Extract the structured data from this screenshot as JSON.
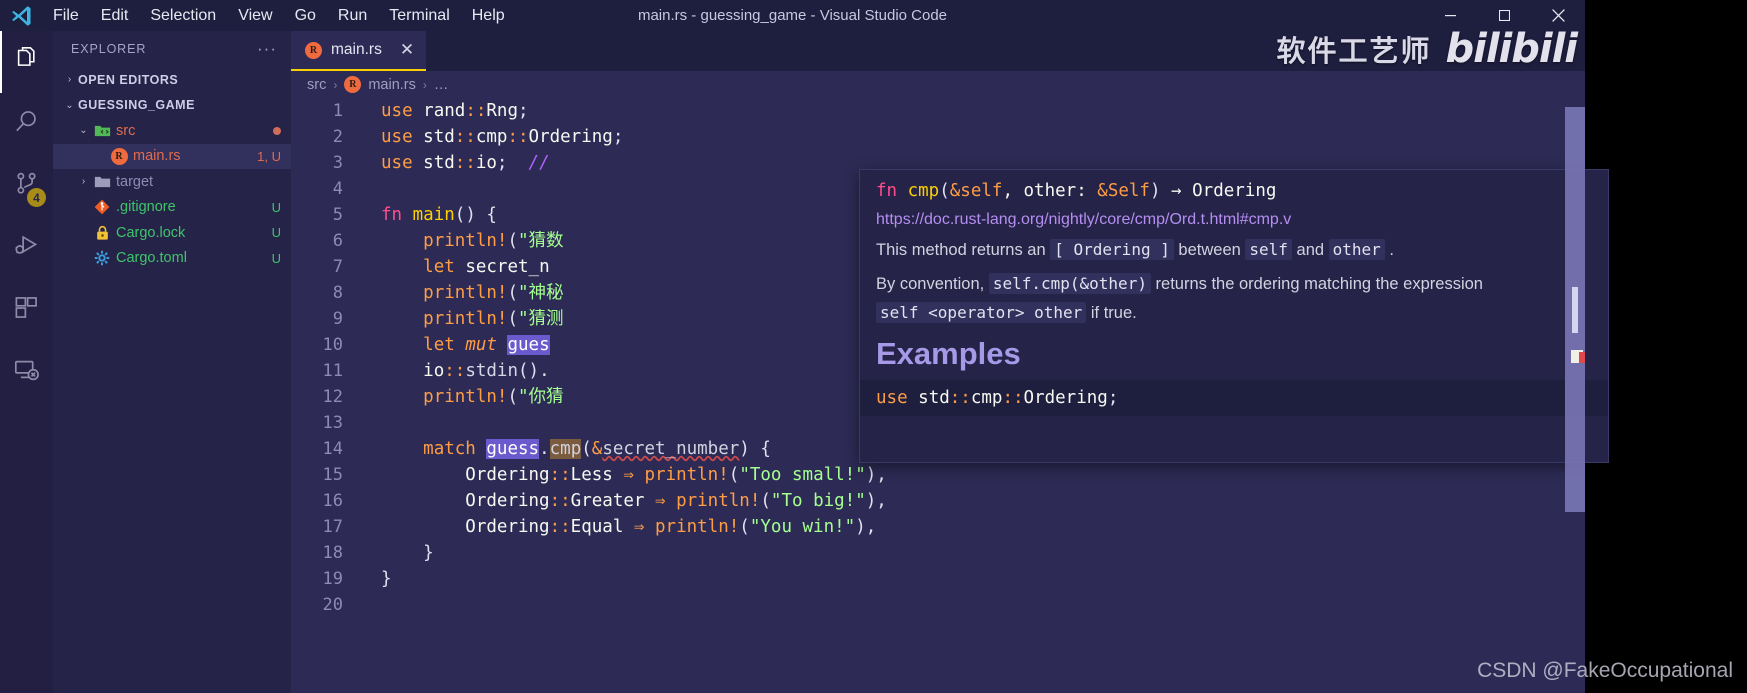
{
  "window": {
    "title": "main.rs - guessing_game - Visual Studio Code",
    "minimize_label": "─",
    "maximize_label": "❐",
    "close_label": "✕"
  },
  "menubar": {
    "items": [
      {
        "label": "File"
      },
      {
        "label": "Edit"
      },
      {
        "label": "Selection"
      },
      {
        "label": "View"
      },
      {
        "label": "Go"
      },
      {
        "label": "Run"
      },
      {
        "label": "Terminal"
      },
      {
        "label": "Help"
      }
    ]
  },
  "activitybar": {
    "items": [
      {
        "name": "explorer",
        "icon": "files-icon",
        "active": true,
        "badge": ""
      },
      {
        "name": "search",
        "icon": "search-icon",
        "active": false,
        "badge": ""
      },
      {
        "name": "source-control",
        "icon": "source-control-icon",
        "active": false,
        "badge": "4"
      },
      {
        "name": "run-and-debug",
        "icon": "run-debug-icon",
        "active": false,
        "badge": ""
      },
      {
        "name": "extensions",
        "icon": "extensions-icon",
        "active": false,
        "badge": ""
      },
      {
        "name": "remote-explorer",
        "icon": "remote-explorer-icon",
        "active": false,
        "badge": ""
      }
    ]
  },
  "sidebar": {
    "title": "EXPLORER",
    "more_actions": "···",
    "sections": [
      {
        "label": "OPEN EDITORS",
        "expanded": false,
        "chevron": "›"
      },
      {
        "label": "GUESSING_GAME",
        "expanded": true,
        "chevron": "⌄"
      }
    ],
    "tree": [
      {
        "name": "src",
        "icon": "folder-src-icon",
        "chevron": "⌄",
        "indent": 1,
        "status": "",
        "modified_dot": true,
        "selected": false,
        "color": "#e06c4f"
      },
      {
        "name": "main.rs",
        "icon": "rust-file-icon",
        "chevron": "",
        "indent": 2,
        "status": "1, U",
        "modified_dot": false,
        "selected": true,
        "color": "#e06c4f"
      },
      {
        "name": "target",
        "icon": "folder-icon",
        "chevron": "›",
        "indent": 1,
        "status": "",
        "modified_dot": false,
        "selected": false,
        "color": "#8d8bb6"
      },
      {
        "name": ".gitignore",
        "icon": "git-icon",
        "chevron": "",
        "indent": 1,
        "status": "U",
        "modified_dot": false,
        "selected": false,
        "color": "#3fc46b"
      },
      {
        "name": "Cargo.lock",
        "icon": "lock-icon",
        "chevron": "",
        "indent": 1,
        "status": "U",
        "modified_dot": false,
        "selected": false,
        "color": "#3fc46b"
      },
      {
        "name": "Cargo.toml",
        "icon": "toml-icon",
        "chevron": "",
        "indent": 1,
        "status": "U",
        "modified_dot": false,
        "selected": false,
        "color": "#3fc46b"
      }
    ]
  },
  "editor": {
    "tabs": [
      {
        "label": "main.rs",
        "icon": "rust-file-icon",
        "active": true,
        "close": "✕"
      }
    ],
    "breadcrumb": [
      "src",
      "main.rs",
      "…"
    ],
    "breadcrumb_separator": "›",
    "lines": [
      {
        "n": "1",
        "tokens": [
          {
            "t": "use",
            "c": "kw"
          },
          {
            "t": " ",
            "c": "id"
          },
          {
            "t": "rand",
            "c": "id"
          },
          {
            "t": "::",
            "c": "colons"
          },
          {
            "t": "Rng",
            "c": "id"
          },
          {
            "t": ";",
            "c": "punct"
          }
        ]
      },
      {
        "n": "2",
        "tokens": [
          {
            "t": "use",
            "c": "kw"
          },
          {
            "t": " ",
            "c": "id"
          },
          {
            "t": "std",
            "c": "id"
          },
          {
            "t": "::",
            "c": "colons"
          },
          {
            "t": "cmp",
            "c": "id"
          },
          {
            "t": "::",
            "c": "colons"
          },
          {
            "t": "Ordering",
            "c": "id"
          },
          {
            "t": ";",
            "c": "punct"
          }
        ]
      },
      {
        "n": "3",
        "tokens": [
          {
            "t": "use",
            "c": "kw"
          },
          {
            "t": " ",
            "c": "id"
          },
          {
            "t": "std",
            "c": "id"
          },
          {
            "t": "::",
            "c": "colons"
          },
          {
            "t": "io",
            "c": "id"
          },
          {
            "t": ";",
            "c": "punct"
          },
          {
            "t": "  ",
            "c": "id"
          },
          {
            "t": "//",
            "c": "comment"
          }
        ]
      },
      {
        "n": "4",
        "tokens": []
      },
      {
        "n": "5",
        "tokens": [
          {
            "t": "fn",
            "c": "kw2"
          },
          {
            "t": " ",
            "c": "id"
          },
          {
            "t": "main",
            "c": "fnname"
          },
          {
            "t": "()",
            "c": "punct"
          },
          {
            "t": " ",
            "c": "id"
          },
          {
            "t": "{",
            "c": "punct"
          }
        ]
      },
      {
        "n": "6",
        "tokens": [
          {
            "t": "    ",
            "c": "id"
          },
          {
            "t": "println!",
            "c": "mac"
          },
          {
            "t": "(",
            "c": "punct"
          },
          {
            "t": "\"猜数",
            "c": "str"
          }
        ]
      },
      {
        "n": "7",
        "tokens": [
          {
            "t": "    ",
            "c": "id"
          },
          {
            "t": "let",
            "c": "kw"
          },
          {
            "t": " ",
            "c": "id"
          },
          {
            "t": "secret_n",
            "c": "id"
          }
        ]
      },
      {
        "n": "8",
        "tokens": [
          {
            "t": "    ",
            "c": "id"
          },
          {
            "t": "println!",
            "c": "mac"
          },
          {
            "t": "(",
            "c": "punct"
          },
          {
            "t": "\"神秘",
            "c": "str"
          }
        ]
      },
      {
        "n": "9",
        "tokens": [
          {
            "t": "    ",
            "c": "id"
          },
          {
            "t": "println!",
            "c": "mac"
          },
          {
            "t": "(",
            "c": "punct"
          },
          {
            "t": "\"猜测",
            "c": "str"
          }
        ]
      },
      {
        "n": "10",
        "tokens": [
          {
            "t": "    ",
            "c": "id"
          },
          {
            "t": "let",
            "c": "kw"
          },
          {
            "t": " ",
            "c": "id"
          },
          {
            "t": "mut",
            "c": "mut"
          },
          {
            "t": " ",
            "c": "id"
          },
          {
            "t": "gues",
            "c": "sel"
          }
        ]
      },
      {
        "n": "11",
        "tokens": [
          {
            "t": "    ",
            "c": "id"
          },
          {
            "t": "io",
            "c": "id"
          },
          {
            "t": "::",
            "c": "colons"
          },
          {
            "t": "stdin",
            "c": "method"
          },
          {
            "t": "().",
            "c": "punct"
          }
        ]
      },
      {
        "n": "12",
        "tokens": [
          {
            "t": "    ",
            "c": "id"
          },
          {
            "t": "println!",
            "c": "mac"
          },
          {
            "t": "(",
            "c": "punct"
          },
          {
            "t": "\"你猜",
            "c": "str"
          }
        ]
      },
      {
        "n": "13",
        "tokens": []
      },
      {
        "n": "14",
        "tokens": [
          {
            "t": "    ",
            "c": "id"
          },
          {
            "t": "match",
            "c": "kw"
          },
          {
            "t": " ",
            "c": "id"
          },
          {
            "t": "guess",
            "c": "sel"
          },
          {
            "t": ".",
            "c": "punct"
          },
          {
            "t": "cmp",
            "c": "sel2"
          },
          {
            "t": "(",
            "c": "punct"
          },
          {
            "t": "&",
            "c": "op"
          },
          {
            "t": "secret_number",
            "c": "squiggly"
          },
          {
            "t": ")",
            "c": "punct"
          },
          {
            "t": " ",
            "c": "id"
          },
          {
            "t": "{",
            "c": "punct"
          }
        ]
      },
      {
        "n": "15",
        "tokens": [
          {
            "t": "        ",
            "c": "id"
          },
          {
            "t": "Ordering",
            "c": "id"
          },
          {
            "t": "::",
            "c": "colons"
          },
          {
            "t": "Less",
            "c": "id"
          },
          {
            "t": " ",
            "c": "id"
          },
          {
            "t": "⇒",
            "c": "op"
          },
          {
            "t": " ",
            "c": "id"
          },
          {
            "t": "println!",
            "c": "mac"
          },
          {
            "t": "(",
            "c": "punct"
          },
          {
            "t": "\"Too small!\"",
            "c": "str"
          },
          {
            "t": "),",
            "c": "punct"
          }
        ]
      },
      {
        "n": "16",
        "tokens": [
          {
            "t": "        ",
            "c": "id"
          },
          {
            "t": "Ordering",
            "c": "id"
          },
          {
            "t": "::",
            "c": "colons"
          },
          {
            "t": "Greater",
            "c": "id"
          },
          {
            "t": " ",
            "c": "id"
          },
          {
            "t": "⇒",
            "c": "op"
          },
          {
            "t": " ",
            "c": "id"
          },
          {
            "t": "println!",
            "c": "mac"
          },
          {
            "t": "(",
            "c": "punct"
          },
          {
            "t": "\"To big!\"",
            "c": "str"
          },
          {
            "t": "),",
            "c": "punct"
          }
        ]
      },
      {
        "n": "17",
        "tokens": [
          {
            "t": "        ",
            "c": "id"
          },
          {
            "t": "Ordering",
            "c": "id"
          },
          {
            "t": "::",
            "c": "colons"
          },
          {
            "t": "Equal",
            "c": "id"
          },
          {
            "t": " ",
            "c": "id"
          },
          {
            "t": "⇒",
            "c": "op"
          },
          {
            "t": " ",
            "c": "id"
          },
          {
            "t": "println!",
            "c": "mac"
          },
          {
            "t": "(",
            "c": "punct"
          },
          {
            "t": "\"You win!\"",
            "c": "str"
          },
          {
            "t": "),",
            "c": "punct"
          }
        ]
      },
      {
        "n": "18",
        "tokens": [
          {
            "t": "    ",
            "c": "id"
          },
          {
            "t": "}",
            "c": "punct"
          }
        ]
      },
      {
        "n": "19",
        "tokens": [
          {
            "t": "}",
            "c": "punct"
          }
        ]
      },
      {
        "n": "20",
        "tokens": []
      }
    ]
  },
  "hover": {
    "signature_parts": [
      {
        "t": "fn ",
        "c": "kw2"
      },
      {
        "t": "cmp",
        "c": "fnname"
      },
      {
        "t": "(",
        "c": "punct"
      },
      {
        "t": "&self",
        "c": "op"
      },
      {
        "t": ", other: ",
        "c": "id"
      },
      {
        "t": "&Self",
        "c": "op"
      },
      {
        "t": ")",
        "c": "punct"
      },
      {
        "t": " → ",
        "c": "id"
      },
      {
        "t": "Ordering",
        "c": "id"
      }
    ],
    "link": "https://doc.rust-lang.org/nightly/core/cmp/Ord.t.html#cmp.v",
    "paragraph1_pre": "This method returns an ",
    "paragraph1_code": "[ Ordering ]",
    "paragraph1_mid": " between ",
    "paragraph1_code2": "self",
    "paragraph1_mid2": " and ",
    "paragraph1_code3": "other",
    "paragraph1_post": " .",
    "paragraph2_pre": "By convention, ",
    "paragraph2_code": "self.cmp(&other)",
    "paragraph2_post": " returns the ordering matching the expression",
    "paragraph3_code": "self <operator> other",
    "paragraph3_post": " if true.",
    "heading": "Examples",
    "code_parts": [
      {
        "t": "use",
        "c": "kw"
      },
      {
        "t": " ",
        "c": "id"
      },
      {
        "t": "std",
        "c": "id"
      },
      {
        "t": "::",
        "c": "colons"
      },
      {
        "t": "cmp",
        "c": "id"
      },
      {
        "t": "::",
        "c": "colons"
      },
      {
        "t": "Ordering",
        "c": "id"
      },
      {
        "t": ";",
        "c": "punct"
      }
    ]
  },
  "watermarks": {
    "bilibili_cn": "软件工艺师",
    "bilibili_logo": "bilibili",
    "csdn": "CSDN @FakeOccupational"
  },
  "colors": {
    "accent": "#fad000",
    "background": "#2d2b55",
    "sidebar": "#252347",
    "titlebar": "#1e1e3f",
    "activitybar": "#231f43",
    "rust_orange": "#e06c4f",
    "git_green": "#3fc46b"
  }
}
